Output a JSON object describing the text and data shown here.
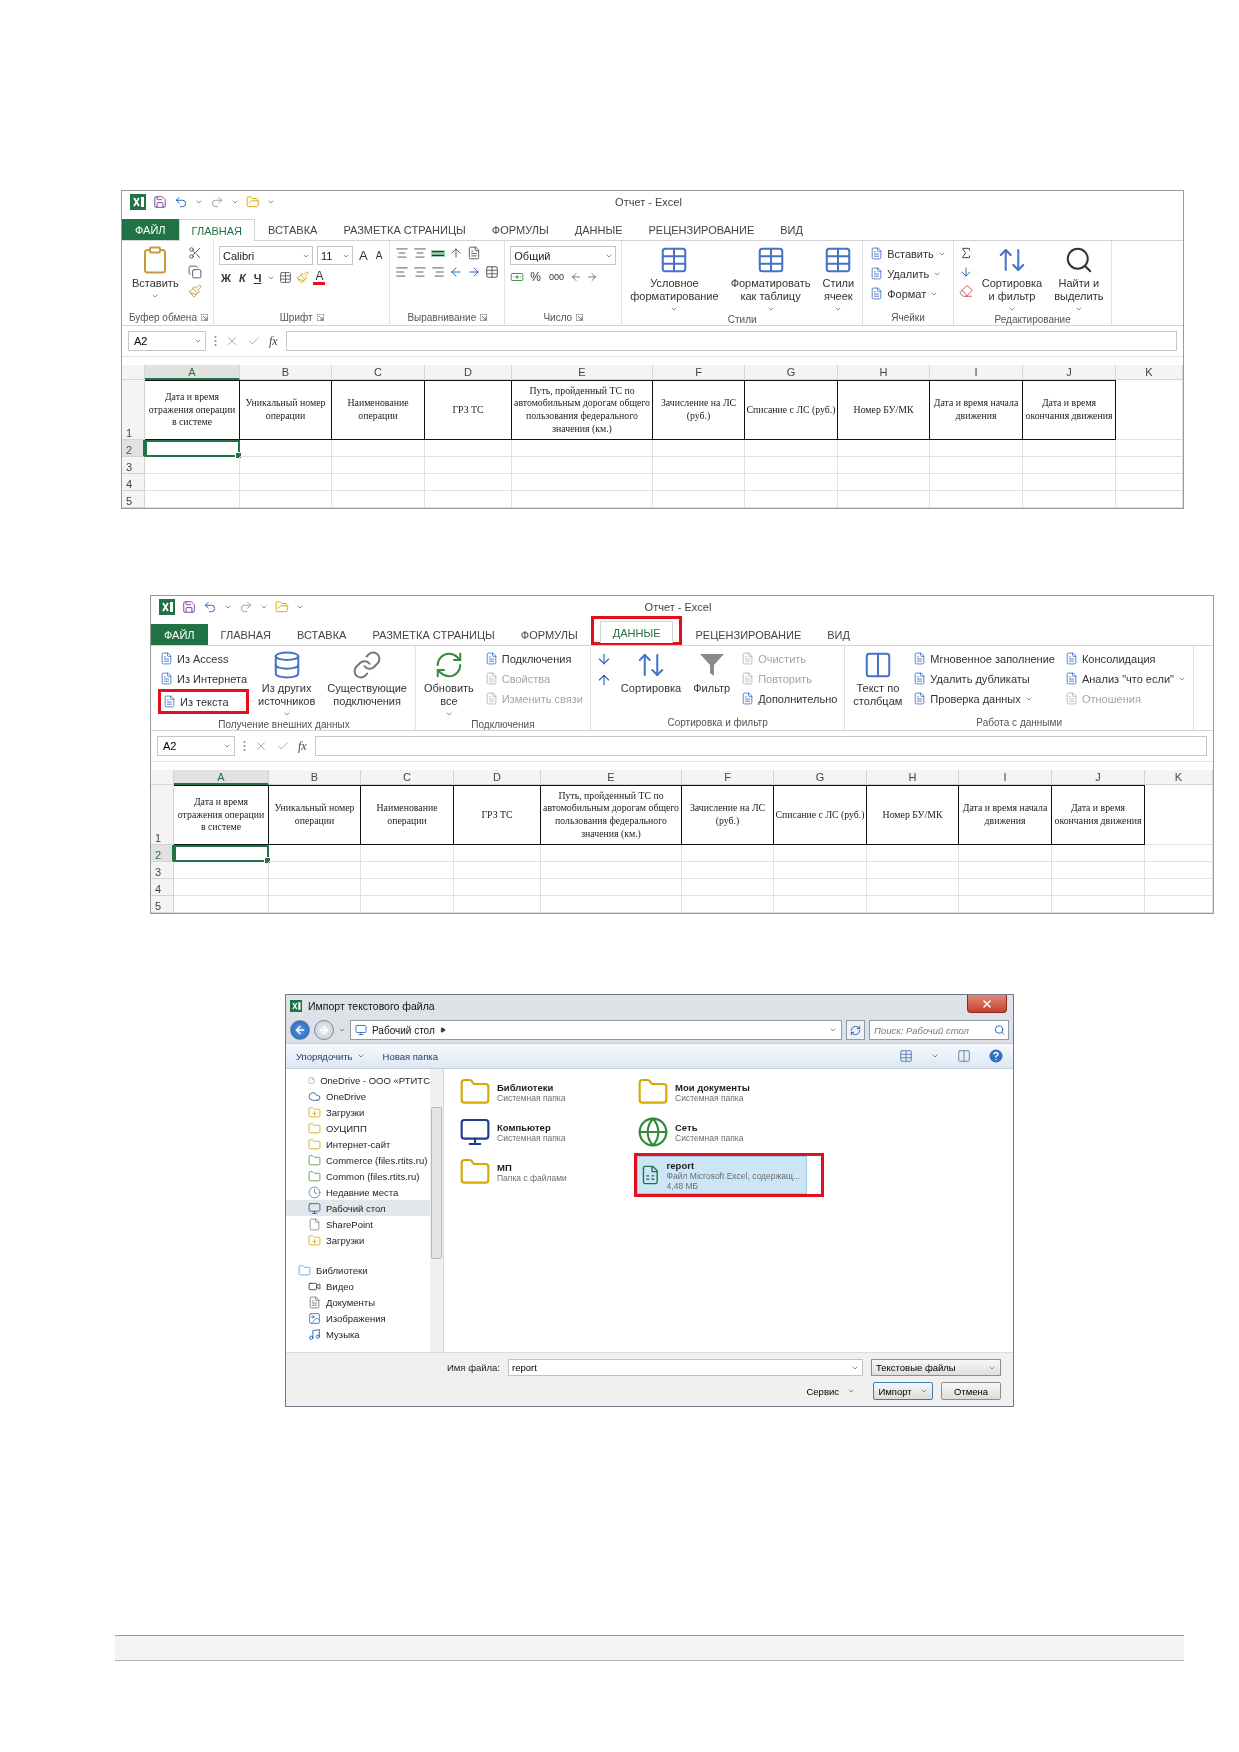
{
  "excel_windows": [
    {
      "title": "Отчет - Excel",
      "tabs": [
        {
          "label": "ФАЙЛ",
          "kind": "file",
          "selected": false,
          "highlighted": false
        },
        {
          "label": "ГЛАВНАЯ",
          "kind": "tab",
          "selected": true,
          "highlighted": false
        },
        {
          "label": "ВСТАВКА",
          "kind": "tab",
          "selected": false,
          "highlighted": false
        },
        {
          "label": "РАЗМЕТКА СТРАНИЦЫ",
          "kind": "tab",
          "selected": false,
          "highlighted": false
        },
        {
          "label": "ФОРМУЛЫ",
          "kind": "tab",
          "selected": false,
          "highlighted": false
        },
        {
          "label": "ДАННЫЕ",
          "kind": "tab",
          "selected": false,
          "highlighted": false
        },
        {
          "label": "РЕЦЕНЗИРОВАНИЕ",
          "kind": "tab",
          "selected": false,
          "highlighted": false
        },
        {
          "label": "ВИД",
          "kind": "tab",
          "selected": false,
          "highlighted": false
        }
      ],
      "ribbon": {
        "groups": [
          {
            "label": "Буфер обмена",
            "launcher": true,
            "items": [
              {
                "kind": "large",
                "lines": [
                  "Вставить"
                ],
                "dropdown": true
              },
              {
                "kind": "clipboard"
              }
            ]
          },
          {
            "label": "Шрифт",
            "launcher": true,
            "items": [
              {
                "kind": "font",
                "font": "Calibri",
                "size": "11",
                "size_buttons": [
                  "A",
                  "A"
                ],
                "style_buttons": [
                  "Ж",
                  "К",
                  "Ч"
                ],
                "color_button": "A"
              }
            ]
          },
          {
            "label": "Выравнивание",
            "launcher": true,
            "items": [
              {
                "kind": "alignment"
              }
            ]
          },
          {
            "label": "Число",
            "launcher": true,
            "items": [
              {
                "kind": "number",
                "format": "Общий",
                "buttons": [
                  "%",
                  "000"
                ]
              }
            ]
          },
          {
            "label": "Стили",
            "launcher": false,
            "items": [
              {
                "kind": "large",
                "lines": [
                  "Условное",
                  "форматирование"
                ],
                "dropdown": true
              },
              {
                "kind": "large",
                "lines": [
                  "Форматировать",
                  "как таблицу"
                ],
                "dropdown": true
              },
              {
                "kind": "large",
                "lines": [
                  "Стили",
                  "ячеек"
                ],
                "dropdown": true
              }
            ]
          },
          {
            "label": "Ячейки",
            "launcher": false,
            "items": [
              {
                "kind": "stack",
                "items": [
                  {
                    "label": "Вставить",
                    "dropdown": true
                  },
                  {
                    "label": "Удалить",
                    "dropdown": true
                  },
                  {
                    "label": "Формат",
                    "dropdown": true
                  }
                ]
              }
            ]
          },
          {
            "label": "Редактирование",
            "launcher": false,
            "items": [
              {
                "kind": "editing"
              },
              {
                "kind": "large",
                "lines": [
                  "Сортировка",
                  "и фильтр"
                ],
                "dropdown": true
              },
              {
                "kind": "large",
                "lines": [
                  "Найти и",
                  "выделить"
                ],
                "dropdown": true
              }
            ]
          }
        ]
      },
      "name_box": "A2",
      "function_label": "fx",
      "grid": {
        "columns": [
          {
            "label": "A",
            "selected": true
          },
          {
            "label": "B",
            "selected": false
          },
          {
            "label": "C",
            "selected": false
          },
          {
            "label": "D",
            "selected": false
          },
          {
            "label": "E",
            "selected": false
          },
          {
            "label": "F",
            "selected": false
          },
          {
            "label": "G",
            "selected": false
          },
          {
            "label": "H",
            "selected": false
          },
          {
            "label": "I",
            "selected": false
          },
          {
            "label": "J",
            "selected": false
          },
          {
            "label": "K",
            "selected": false
          }
        ],
        "rows": [
          {
            "label": "1",
            "selected": false
          },
          {
            "label": "2",
            "selected": true
          },
          {
            "label": "3",
            "selected": false
          },
          {
            "label": "4",
            "selected": false
          },
          {
            "label": "5",
            "selected": false
          }
        ],
        "header_cells": [
          "Дата и время отражения операции в системе",
          "Уникальный номер операции",
          "Наименование операции",
          "ГРЗ ТС",
          "Путь, пройденный ТС по автомобильным дорогам общего пользования федерального значения (км.)",
          "Зачисление на ЛС (руб.)",
          "Списание с ЛС (руб.)",
          "Номер БУ/МК",
          "Дата и время начала движения",
          "Дата и время окончания движения"
        ]
      }
    },
    {
      "title": "Отчет - Excel",
      "tabs": [
        {
          "label": "ФАЙЛ",
          "kind": "file",
          "selected": false,
          "highlighted": false
        },
        {
          "label": "ГЛАВНАЯ",
          "kind": "tab",
          "selected": false,
          "highlighted": false
        },
        {
          "label": "ВСТАВКА",
          "kind": "tab",
          "selected": false,
          "highlighted": false
        },
        {
          "label": "РАЗМЕТКА СТРАНИЦЫ",
          "kind": "tab",
          "selected": false,
          "highlighted": false
        },
        {
          "label": "ФОРМУЛЫ",
          "kind": "tab",
          "selected": false,
          "highlighted": false
        },
        {
          "label": "ДАННЫЕ",
          "kind": "tab",
          "selected": true,
          "highlighted": true
        },
        {
          "label": "РЕЦЕНЗИРОВАНИЕ",
          "kind": "tab",
          "selected": false,
          "highlighted": false
        },
        {
          "label": "ВИД",
          "kind": "tab",
          "selected": false,
          "highlighted": false
        }
      ],
      "ribbon": {
        "groups": [
          {
            "label": "Получение внешних данных",
            "launcher": false,
            "items": [
              {
                "kind": "stack",
                "items": [
                  {
                    "label": "Из Access",
                    "highlighted": false
                  },
                  {
                    "label": "Из Интернета",
                    "highlighted": false
                  },
                  {
                    "label": "Из текста",
                    "highlighted": true
                  }
                ]
              },
              {
                "kind": "large",
                "lines": [
                  "Из других",
                  "источников"
                ],
                "dropdown": true
              },
              {
                "kind": "large",
                "lines": [
                  "Существующие",
                  "подключения"
                ],
                "dropdown": false
              }
            ]
          },
          {
            "label": "Подключения",
            "launcher": false,
            "items": [
              {
                "kind": "large",
                "lines": [
                  "Обновить",
                  "все"
                ],
                "dropdown": true
              },
              {
                "kind": "stack",
                "items": [
                  {
                    "label": "Подключения",
                    "disabled": false
                  },
                  {
                    "label": "Свойства",
                    "disabled": true
                  },
                  {
                    "label": "Изменить связи",
                    "disabled": true
                  }
                ]
              }
            ]
          },
          {
            "label": "Сортировка и фильтр",
            "launcher": false,
            "items": [
              {
                "kind": "sorting"
              },
              {
                "kind": "large",
                "lines": [
                  "Сортировка"
                ],
                "dropdown": false
              },
              {
                "kind": "large",
                "lines": [
                  "Фильтр"
                ],
                "dropdown": false
              },
              {
                "kind": "stack",
                "items": [
                  {
                    "label": "Очистить",
                    "disabled": true
                  },
                  {
                    "label": "Повторить",
                    "disabled": true
                  },
                  {
                    "label": "Дополнительно",
                    "disabled": false
                  }
                ]
              }
            ]
          },
          {
            "label": "Работа с данными",
            "launcher": false,
            "items": [
              {
                "kind": "large",
                "lines": [
                  "Текст по",
                  "столбцам"
                ],
                "dropdown": false
              },
              {
                "kind": "stack",
                "items": [
                  {
                    "label": "Мгновенное заполнение",
                    "dropdown": false
                  },
                  {
                    "label": "Удалить дубликаты",
                    "dropdown": false
                  },
                  {
                    "label": "Проверка данных",
                    "dropdown": true
                  }
                ]
              },
              {
                "kind": "stack",
                "items": [
                  {
                    "label": "Консолидация",
                    "dropdown": false,
                    "disabled": false
                  },
                  {
                    "label": "Анализ \"что если\"",
                    "dropdown": true,
                    "disabled": false
                  },
                  {
                    "label": "Отношения",
                    "dropdown": false,
                    "disabled": true
                  }
                ]
              }
            ]
          }
        ]
      },
      "name_box": "A2",
      "function_label": "fx",
      "grid": {
        "columns": [
          {
            "label": "A",
            "selected": true
          },
          {
            "label": "B",
            "selected": false
          },
          {
            "label": "C",
            "selected": false
          },
          {
            "label": "D",
            "selected": false
          },
          {
            "label": "E",
            "selected": false
          },
          {
            "label": "F",
            "selected": false
          },
          {
            "label": "G",
            "selected": false
          },
          {
            "label": "H",
            "selected": false
          },
          {
            "label": "I",
            "selected": false
          },
          {
            "label": "J",
            "selected": false
          },
          {
            "label": "K",
            "selected": false
          }
        ],
        "rows": [
          {
            "label": "1",
            "selected": false
          },
          {
            "label": "2",
            "selected": true
          },
          {
            "label": "3",
            "selected": false
          },
          {
            "label": "4",
            "selected": false
          },
          {
            "label": "5",
            "selected": false
          }
        ],
        "header_cells": [
          "Дата и время отражения операции в системе",
          "Уникальный номер операции",
          "Наименование операции",
          "ГРЗ ТС",
          "Путь, пройденный ТС по автомобильным дорогам общего пользования федерального значения (км.)",
          "Зачисление на ЛС (руб.)",
          "Списание с ЛС (руб.)",
          "Номер БУ/МК",
          "Дата и время начала движения",
          "Дата и время окончания движения"
        ]
      }
    }
  ],
  "import_dialog": {
    "title": "Импорт текстового файла",
    "path": "Рабочий стол",
    "search_placeholder": "Поиск: Рабочий стол",
    "toolbar": [
      {
        "label": "Упорядочить",
        "dropdown": true
      },
      {
        "label": "Новая папка",
        "dropdown": false
      }
    ],
    "nav": [
      {
        "label": "OneDrive - ООО «РТИТС",
        "kind": "file",
        "selected": false
      },
      {
        "label": "OneDrive",
        "kind": "cloud",
        "selected": false
      },
      {
        "label": "Загрузки",
        "kind": "download",
        "selected": false
      },
      {
        "label": "ОУЦИПП",
        "kind": "folder",
        "selected": false
      },
      {
        "label": "Интернет-сайт",
        "kind": "folder",
        "selected": false
      },
      {
        "label": "Commerce (files.rtits.ru)",
        "kind": "share",
        "selected": false
      },
      {
        "label": "Common (files.rtits.ru)",
        "kind": "share",
        "selected": false
      },
      {
        "label": "Недавние места",
        "kind": "recent",
        "selected": false
      },
      {
        "label": "Рабочий стол",
        "kind": "desktop",
        "selected": true
      },
      {
        "label": "SharePoint",
        "kind": "file",
        "selected": false
      },
      {
        "label": "Загрузки",
        "kind": "download",
        "selected": false
      },
      {
        "label": "Библиотеки",
        "kind": "library",
        "selected": false,
        "children": [
          {
            "label": "Видео",
            "kind": "video",
            "selected": false
          },
          {
            "label": "Документы",
            "kind": "docs",
            "selected": false
          },
          {
            "label": "Изображения",
            "kind": "images",
            "selected": false
          },
          {
            "label": "Музыка",
            "kind": "music",
            "selected": false
          }
        ]
      }
    ],
    "tiles": [
      {
        "name": "Библиотеки",
        "detail": "Системная папка",
        "kind": "library",
        "selected": false,
        "highlighted": false
      },
      {
        "name": "Мои документы",
        "detail": "Системная папка",
        "kind": "folder",
        "selected": false,
        "highlighted": false
      },
      {
        "name": "Компьютер",
        "detail": "Системная папка",
        "kind": "computer",
        "selected": false,
        "highlighted": false
      },
      {
        "name": "Сеть",
        "detail": "Системная папка",
        "kind": "network",
        "selected": false,
        "highlighted": false
      },
      {
        "name": "МП",
        "detail": "Папка с файлами",
        "kind": "folder",
        "selected": false,
        "highlighted": false
      },
      {
        "name": "report",
        "detail": "Файл Microsoft Excel, содержащ...",
        "size": "4,48 МБ",
        "kind": "excel",
        "selected": true,
        "highlighted": true
      }
    ],
    "file_name_label": "Имя файла:",
    "file_name": "report",
    "file_type": "Текстовые файлы",
    "tools": "Сервис",
    "buttons": [
      {
        "label": "Импорт",
        "kind": "split"
      },
      {
        "label": "Отмена",
        "kind": "plain"
      }
    ]
  }
}
